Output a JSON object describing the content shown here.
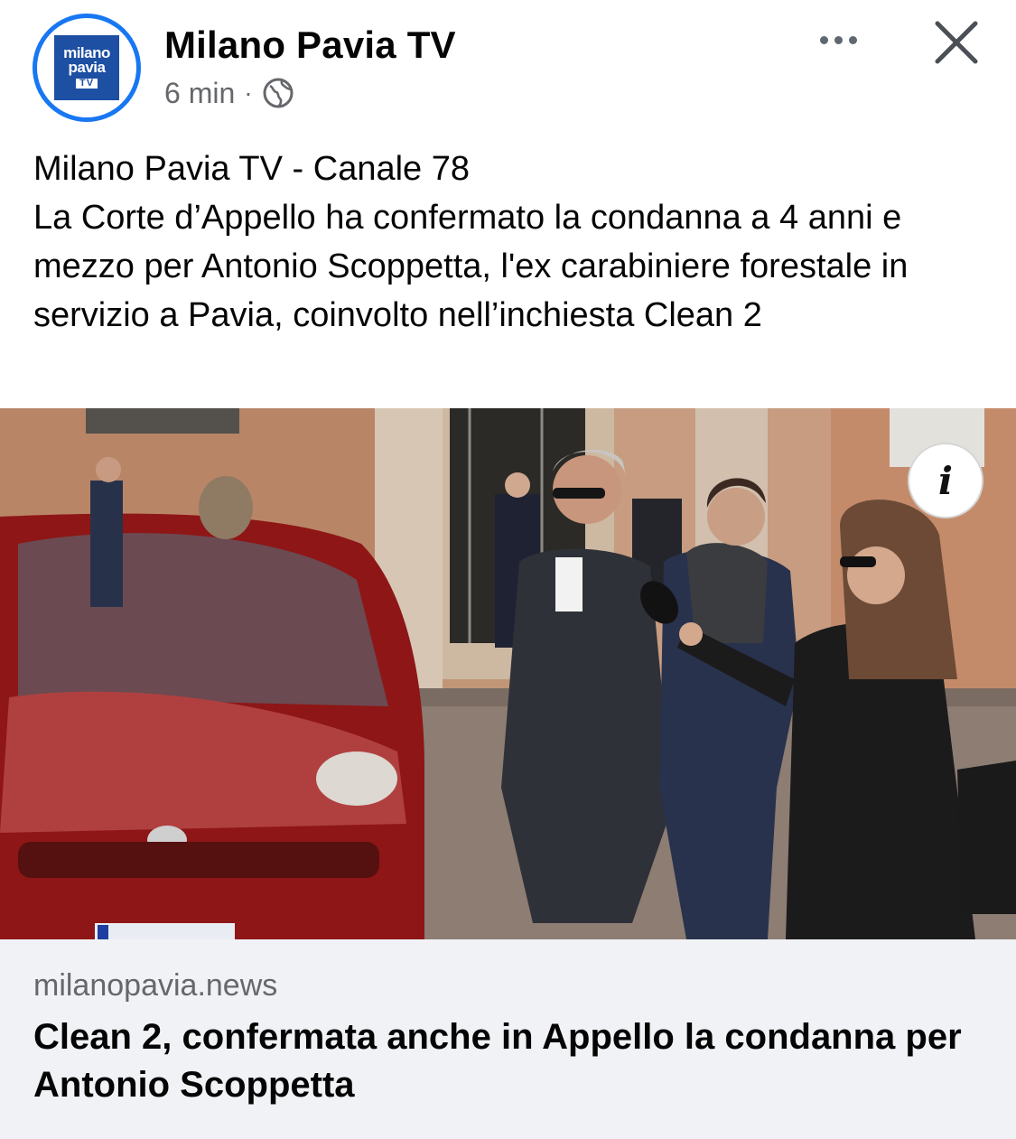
{
  "header": {
    "page_name": "Milano Pavia TV",
    "time": "6 min",
    "separator": "·",
    "avatar": {
      "line1": "milano",
      "line2": "pavia",
      "line3": "TV"
    },
    "icons": {
      "audience": "globe-icon",
      "more": "more-icon",
      "close": "close-icon"
    }
  },
  "caption": {
    "line1": "Milano Pavia TV - Canale 78",
    "body": "La Corte d’Appello ha confermato la condanna a 4 anni e mezzo per Antonio Scoppetta, l'ex carabiniere forestale in servizio a Pavia, coinvolto nell’inchiesta Clean 2"
  },
  "photo": {
    "info_glyph": "i"
  },
  "link_preview": {
    "domain": "milanopavia.news",
    "title": "Clean 2, confermata anche in Appello la condanna per Antonio Scoppetta"
  },
  "colors": {
    "accent": "#1877f2",
    "secondary_text": "#65676b",
    "link_bg": "#f0f2f5"
  }
}
